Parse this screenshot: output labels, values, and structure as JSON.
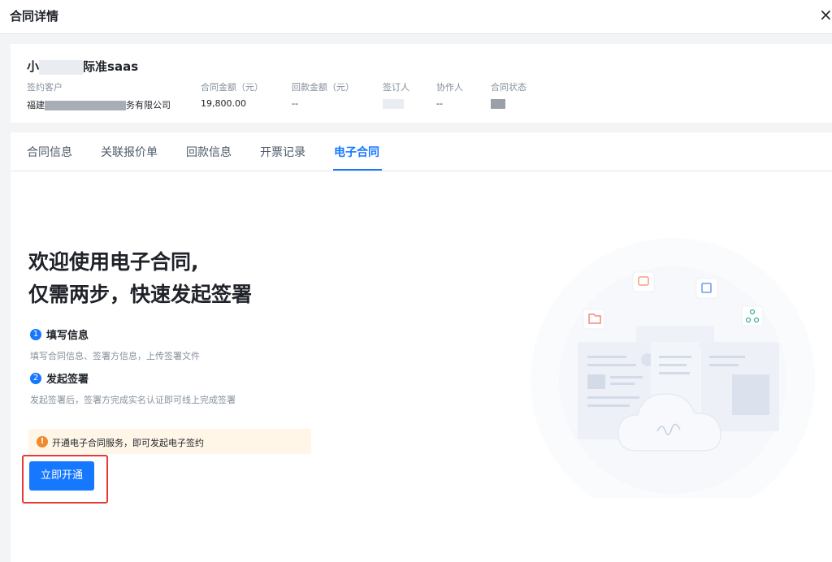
{
  "header": {
    "title": "合同详情",
    "close_label": "×"
  },
  "contract": {
    "name_prefix": "小",
    "name_suffix": "际准saas",
    "fields": [
      {
        "label": "签约客户",
        "value_prefix": "福建",
        "value_suffix": "务有限公司"
      },
      {
        "label": "合同金额（元）",
        "value": "19,800.00"
      },
      {
        "label": "回款金额（元）",
        "value": "--"
      },
      {
        "label": "签订人",
        "value": ""
      },
      {
        "label": "协作人",
        "value": "--"
      },
      {
        "label": "合同状态",
        "value": ""
      }
    ]
  },
  "tabs": [
    {
      "label": "合同信息",
      "active": false
    },
    {
      "label": "关联报价单",
      "active": false
    },
    {
      "label": "回款信息",
      "active": false
    },
    {
      "label": "开票记录",
      "active": false
    },
    {
      "label": "电子合同",
      "active": true
    }
  ],
  "welcome": {
    "line1": "欢迎使用电子合同,",
    "line2": "仅需两步，快速发起签署"
  },
  "steps": [
    {
      "number": "1",
      "title": "填写信息",
      "desc": "填写合同信息、签署方信息，上传签署文件"
    },
    {
      "number": "2",
      "title": "发起签署",
      "desc": "发起签署后，签署方完成实名认证即可线上完成签署"
    }
  ],
  "notice": {
    "icon": "!",
    "text": "开通电子合同服务，即可发起电子签约"
  },
  "action": {
    "open_label": "立即开通"
  },
  "colors": {
    "accent": "#1677ff",
    "warning": "#f08a2b",
    "highlight": "#e53935"
  }
}
